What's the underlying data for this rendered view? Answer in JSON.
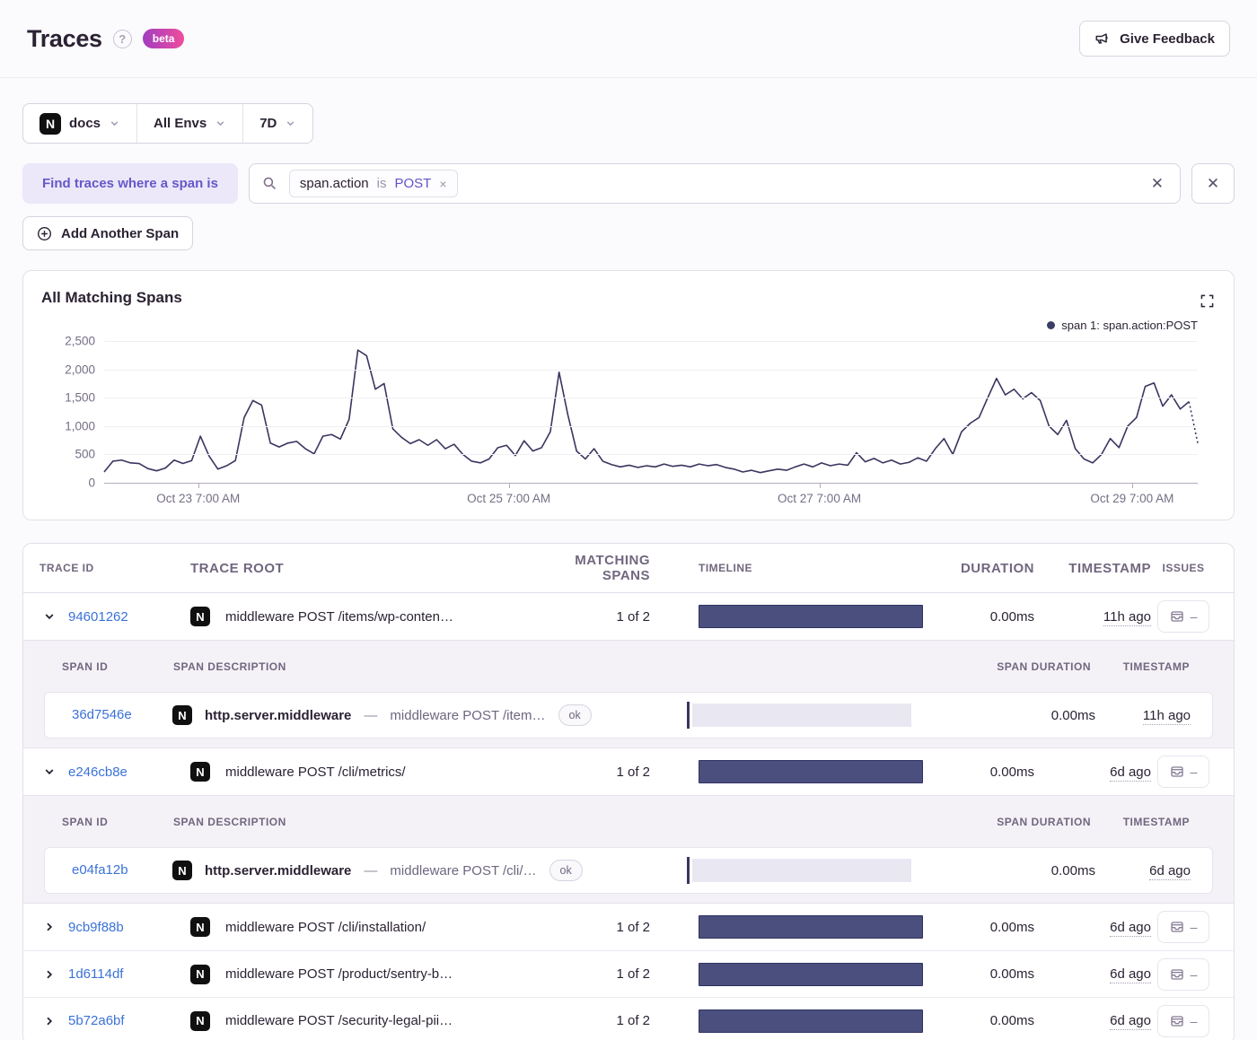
{
  "page": {
    "title": "Traces",
    "beta": "beta"
  },
  "icons": {
    "help": "?",
    "close": "✕",
    "remove": "×",
    "dash": "—",
    "none": "–"
  },
  "colors": {
    "accent_purple": "#6558c8",
    "link_blue": "#3b72d8",
    "line": "#3a355f",
    "timeline_bar": "#4b4f7d",
    "beta_from": "#a13dc0",
    "beta_to": "#ef4d9e"
  },
  "header": {
    "feedback": "Give Feedback"
  },
  "filters": {
    "project": "docs",
    "environment": "All Envs",
    "period": "7D"
  },
  "query": {
    "label": "Find traces where a span is",
    "token_key": "span.action",
    "token_op": "is",
    "token_value": "POST",
    "add_span": "Add Another Span"
  },
  "chart": {
    "title": "All Matching Spans",
    "legend": "span 1: span.action:POST"
  },
  "chart_data": {
    "type": "line",
    "title": "All Matching Spans",
    "ylabel": "",
    "xlabel": "",
    "ylim": [
      0,
      2500
    ],
    "y_ticks": [
      "0",
      "500",
      "1,000",
      "1,500",
      "2,000",
      "2,500"
    ],
    "x_ticks": [
      "Oct 23 7:00 AM",
      "Oct 25 7:00 AM",
      "Oct 27 7:00 AM",
      "Oct 29 7:00 AM"
    ],
    "x_tick_positions_pct": [
      8.6,
      37,
      65.4,
      94
    ],
    "grid": "horizontal",
    "legend_position": "top-right",
    "dashed_tail_from_index": 124,
    "series": [
      {
        "name": "span 1: span.action:POST",
        "color": "#3a355f",
        "values": [
          190,
          380,
          400,
          350,
          340,
          250,
          210,
          260,
          400,
          340,
          390,
          820,
          470,
          240,
          300,
          390,
          1150,
          1450,
          1370,
          700,
          630,
          700,
          730,
          600,
          510,
          820,
          850,
          770,
          1120,
          2340,
          2240,
          1650,
          1750,
          950,
          800,
          690,
          760,
          660,
          760,
          600,
          680,
          500,
          380,
          350,
          420,
          620,
          660,
          480,
          740,
          560,
          620,
          900,
          1950,
          1200,
          560,
          420,
          600,
          380,
          320,
          280,
          310,
          270,
          300,
          280,
          330,
          290,
          310,
          280,
          330,
          300,
          320,
          270,
          240,
          190,
          220,
          180,
          210,
          240,
          220,
          280,
          330,
          280,
          350,
          300,
          330,
          310,
          530,
          370,
          430,
          350,
          400,
          330,
          360,
          440,
          380,
          600,
          780,
          500,
          900,
          1050,
          1150,
          1500,
          1840,
          1550,
          1650,
          1480,
          1590,
          1450,
          1000,
          850,
          1100,
          600,
          420,
          350,
          500,
          780,
          620,
          1000,
          1150,
          1700,
          1760,
          1350,
          1550,
          1300,
          1430,
          700
        ]
      }
    ]
  },
  "table": {
    "columns": [
      "Trace ID",
      "Trace Root",
      "Matching Spans",
      "Timeline",
      "Duration",
      "Timestamp",
      "Issues"
    ],
    "span_columns": [
      "Span ID",
      "Span Description",
      "Span Duration",
      "Timestamp"
    ],
    "rows": [
      {
        "id": "94601262",
        "root": "middleware POST /items/wp-conten…",
        "matching": "1 of 2",
        "duration": "0.00ms",
        "timestamp": "11h ago",
        "spans": [
          {
            "id": "36d7546e",
            "op": "http.server.middleware",
            "desc": "middleware POST /item…",
            "status": "ok",
            "duration": "0.00ms",
            "timestamp": "11h ago"
          }
        ]
      },
      {
        "id": "e246cb8e",
        "root": "middleware POST /cli/metrics/",
        "matching": "1 of 2",
        "duration": "0.00ms",
        "timestamp": "6d ago",
        "spans": [
          {
            "id": "e04fa12b",
            "op": "http.server.middleware",
            "desc": "middleware POST /cli/…",
            "status": "ok",
            "duration": "0.00ms",
            "timestamp": "6d ago"
          }
        ]
      },
      {
        "id": "9cb9f88b",
        "root": "middleware POST /cli/installation/",
        "matching": "1 of 2",
        "duration": "0.00ms",
        "timestamp": "6d ago",
        "spans": []
      },
      {
        "id": "1d6114df",
        "root": "middleware POST /product/sentry-b…",
        "matching": "1 of 2",
        "duration": "0.00ms",
        "timestamp": "6d ago",
        "spans": []
      },
      {
        "id": "5b72a6bf",
        "root": "middleware POST /security-legal-pii…",
        "matching": "1 of 2",
        "duration": "0.00ms",
        "timestamp": "6d ago",
        "spans": []
      }
    ]
  }
}
